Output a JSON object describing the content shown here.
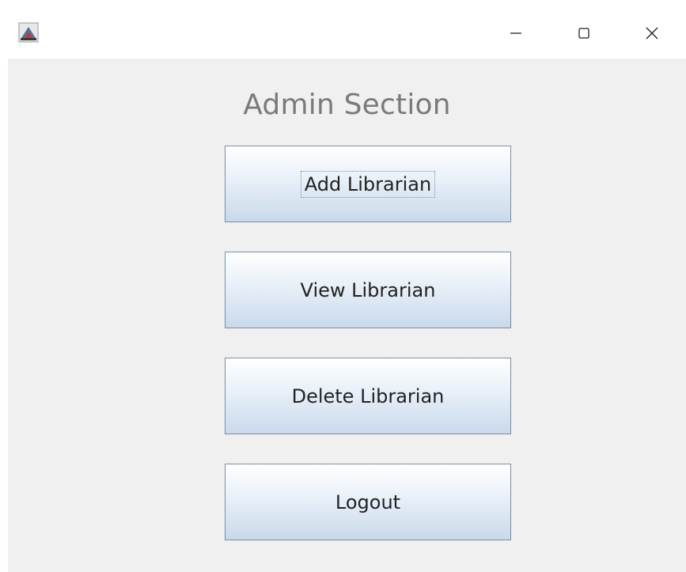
{
  "window": {
    "minimize_icon": "minimize-icon",
    "maximize_icon": "maximize-icon",
    "close_icon": "close-icon",
    "app_icon": "java-app-icon"
  },
  "admin": {
    "title": "Admin Section",
    "buttons": {
      "add": "Add Librarian",
      "view": "View Librarian",
      "delete": "Delete Librarian",
      "logout": "Logout"
    }
  },
  "colors": {
    "panel_bg": "#f0f0f0",
    "title_text": "#7a7a7a",
    "button_border": "#7a8ea8",
    "button_gradient_top": "#ffffff",
    "button_gradient_bottom": "#c9d9eb"
  }
}
